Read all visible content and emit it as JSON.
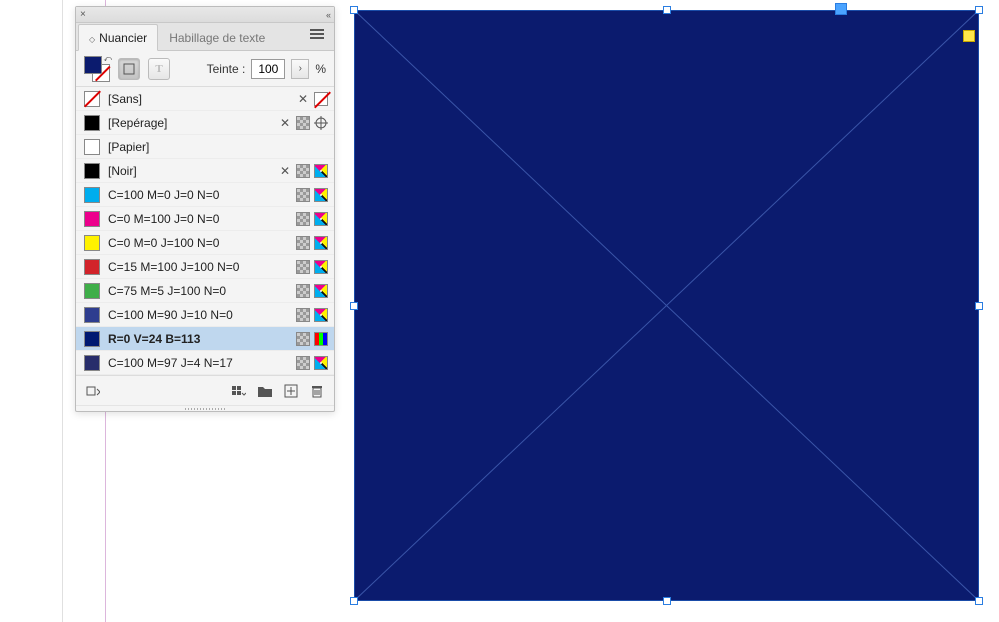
{
  "panel": {
    "tabs": {
      "swatches": "Nuancier",
      "text_wrap": "Habillage de texte"
    },
    "tint_label": "Teinte :",
    "tint_value": "100",
    "tint_suffix": "%"
  },
  "swatches": [
    {
      "name": "[Sans]",
      "color": "none",
      "noedit": true,
      "mode": "none"
    },
    {
      "name": "[Repérage]",
      "color": "#000000",
      "noedit": true,
      "mode": "registration"
    },
    {
      "name": "[Papier]",
      "color": "#ffffff",
      "noedit": false,
      "mode": ""
    },
    {
      "name": "[Noir]",
      "color": "#000000",
      "noedit": true,
      "mode": "cmyk"
    },
    {
      "name": "C=100 M=0 J=0 N=0",
      "color": "#00adee",
      "noedit": false,
      "mode": "cmyk"
    },
    {
      "name": "C=0 M=100 J=0 N=0",
      "color": "#ec008c",
      "noedit": false,
      "mode": "cmyk"
    },
    {
      "name": "C=0 M=0 J=100 N=0",
      "color": "#fff200",
      "noedit": false,
      "mode": "cmyk"
    },
    {
      "name": "C=15 M=100 J=100 N=0",
      "color": "#d2232a",
      "noedit": false,
      "mode": "cmyk"
    },
    {
      "name": "C=75 M=5 J=100 N=0",
      "color": "#3fae49",
      "noedit": false,
      "mode": "cmyk"
    },
    {
      "name": "C=100 M=90 J=10 N=0",
      "color": "#2e3d8f",
      "noedit": false,
      "mode": "cmyk"
    },
    {
      "name": "R=0 V=24 B=113",
      "color": "#001871",
      "noedit": false,
      "mode": "rgb",
      "selected": true
    },
    {
      "name": "C=100 M=97 J=4 N=17",
      "color": "#282d6b",
      "noedit": false,
      "mode": "cmyk"
    }
  ],
  "canvas": {
    "fill": "#0b1b6e",
    "stroke": "#2a7de1"
  }
}
